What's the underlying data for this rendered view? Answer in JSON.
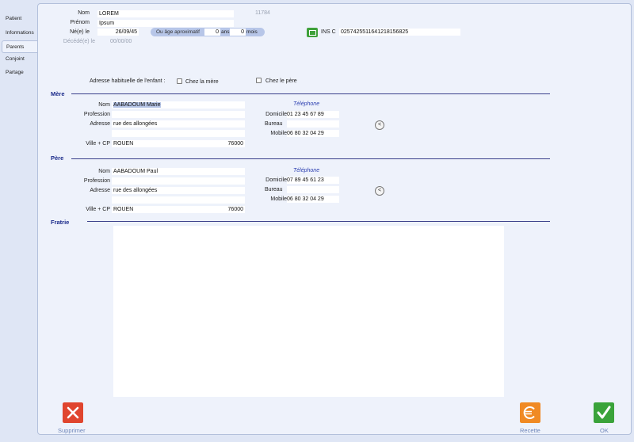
{
  "tabs": [
    "Patient",
    "Informations",
    "Parents",
    "Conjoint",
    "Partage"
  ],
  "identity": {
    "nom_label": "Nom",
    "nom": "LOREM",
    "id_number": "11784",
    "prenom_label": "Prénom",
    "prenom": "Ipsum",
    "nele_label": "Né(e) le",
    "nele": "26/09/45",
    "age_label": "Ou âge aproximatif",
    "age_years": "0",
    "ans_label": "ans",
    "age_months": "0",
    "mois_label": "mois",
    "ins_label": "INS C",
    "ins_value": "0257425511641218156825",
    "decede_label": "Décédé(e) le",
    "decede": "00/00/00"
  },
  "address_choice": {
    "label": "Adresse habituelle de l'enfant :",
    "mere": "Chez la mère",
    "pere": "Chez le père"
  },
  "labels": {
    "nom": "Nom",
    "profession": "Profession",
    "adresse": "Adresse",
    "ville_cp": "Ville + CP",
    "telephone": "Téléphone",
    "domicile": "Domicile",
    "bureau": "Bureau",
    "mobile": "Mobile"
  },
  "mere": {
    "title": "Mère",
    "nom": "AABADOUM Marie",
    "profession": "",
    "adresse": "rue des allongées",
    "adresse2": "",
    "ville": "ROUEN",
    "cp": "76000",
    "domicile": "01 23 45 67 89",
    "bureau": "",
    "mobile": "06 80 32 04 29",
    "arrow": "<"
  },
  "pere": {
    "title": "Père",
    "nom": "AABADOUM Paul",
    "profession": "",
    "adresse": "rue des allongées",
    "adresse2": "",
    "ville": "ROUEN",
    "cp": "76000",
    "domicile": "07 89 45 61 23",
    "bureau": "",
    "mobile": "06 80 32 04 29",
    "arrow": "<"
  },
  "fratrie": {
    "title": "Fratrie"
  },
  "buttons": {
    "supprimer": "Supprimer",
    "recette": "Recette",
    "ok": "OK"
  },
  "colors": {
    "accent": "#1a2a8a",
    "supprimer": "#e0452e",
    "recette": "#f08a24",
    "ok": "#3aa33a"
  },
  "icons": {
    "delete": "close-icon",
    "recette": "euro-icon",
    "ok": "checkmark-icon",
    "ins": "card-icon"
  }
}
